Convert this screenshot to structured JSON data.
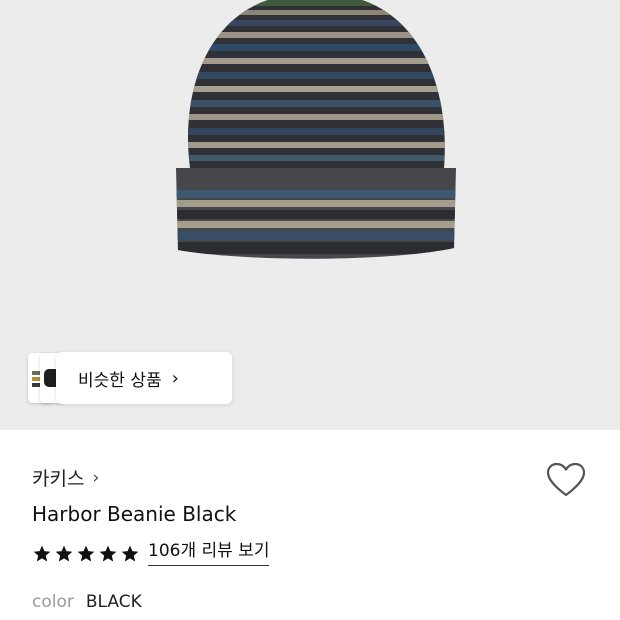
{
  "hero": {
    "image": "beanie-product-image"
  },
  "similar": {
    "label": "비슷한 상품",
    "chevron": "chevron-right-icon"
  },
  "product": {
    "brand": "카키스",
    "brand_chevron": "chevron-right-icon",
    "name": "Harbor Beanie Black",
    "rating_stars": 5,
    "reviews_link": "106개 리뷰 보기",
    "color_label": "color",
    "color_value": "BLACK"
  },
  "icons": {
    "wishlist": "heart-icon",
    "star": "star-icon"
  },
  "colors": {
    "hero_bg": "#ececec",
    "star": "#111111",
    "muted": "#999999"
  }
}
